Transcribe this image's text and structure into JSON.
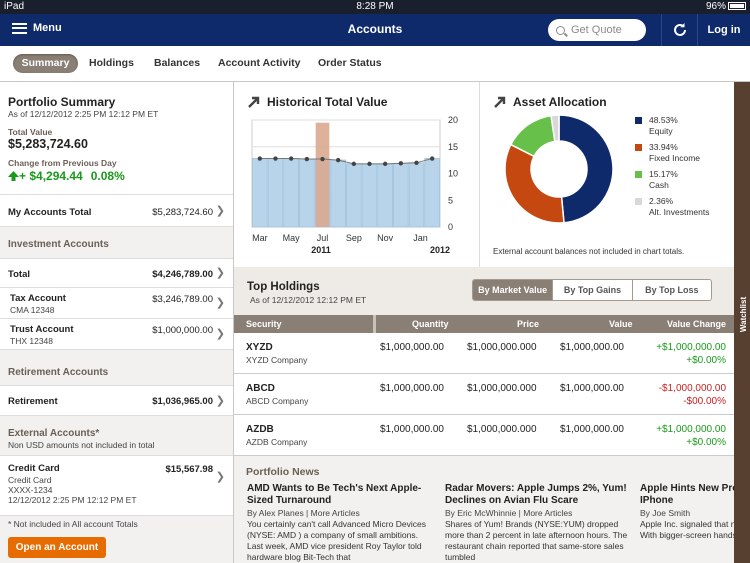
{
  "status_bar": {
    "device": "iPad",
    "time": "8:28 PM",
    "battery": "96%"
  },
  "nav": {
    "menu_label": "Menu",
    "title": "Accounts",
    "quote_placeholder": "Get Quote",
    "login_label": "Log in"
  },
  "tabs": [
    "Summary",
    "Holdings",
    "Balances",
    "Account Activity",
    "Order Status"
  ],
  "left": {
    "portfolio_title": "Portfolio Summary",
    "as_of": "As of 12/12/2012 2:25 PM 12:12 PM ET",
    "total_value_label": "Total Value",
    "total_value": "$5,283,724.60",
    "change_label": "Change from Previous Day",
    "change_value": "+ $4,294.44",
    "change_pct": "0.08%",
    "my_accounts_label": "My Accounts Total",
    "my_accounts_value": "$5,283,724.60",
    "investment_header": "Investment Accounts",
    "inv_total_label": "Total",
    "inv_total_value": "$4,246,789.00",
    "tax_label": "Tax Account",
    "tax_sub": "CMA 12348",
    "tax_value": "$3,246,789.00",
    "trust_label": "Trust Account",
    "trust_sub": "THX 12348",
    "trust_value": "$1,000,000.00",
    "retirement_header": "Retirement Accounts",
    "retirement_label": "Retirement",
    "retirement_value": "$1,036,965.00",
    "external_header": "External Accounts*",
    "external_note": "Non USD amounts not included in total",
    "cc_label": "Credit Card",
    "cc_value": "$15,567.98",
    "cc_sub1": "Credit Card",
    "cc_sub2": "XXXX-1234",
    "cc_sub3": "12/12/2012 2:25 PM 12:12 PM ET",
    "footnote": "* Not included in All account Totals",
    "open_account": "Open an Account"
  },
  "historical": {
    "title": "Historical Total Value"
  },
  "allocation": {
    "title": "Asset Allocation",
    "legend": [
      {
        "pct": "48.53%",
        "label": "Equity",
        "color": "#0e2a6b"
      },
      {
        "pct": "33.94%",
        "label": "Fixed Income",
        "color": "#c4480f"
      },
      {
        "pct": "15.17%",
        "label": "Cash",
        "color": "#66c04a"
      },
      {
        "pct": "2.36%",
        "label": "Alt. Investments",
        "color": "#d8d8d8"
      }
    ],
    "note": "External account balances not included in chart totals."
  },
  "chart_data": [
    {
      "type": "bar",
      "x_ticks": [
        "Mar",
        "May",
        "Jul",
        "Sep",
        "Nov",
        "Jan"
      ],
      "x_year_labels": [
        "2011",
        "2012"
      ],
      "y_ticks": [
        "0",
        "5",
        "10",
        "15",
        "20"
      ],
      "ylim": [
        0,
        20
      ],
      "values": [
        12.8,
        12.8,
        12.8,
        12.7,
        12.7,
        12.5,
        11.8,
        11.8,
        11.8,
        11.9,
        12.0,
        12.8
      ],
      "highlight_index": 4,
      "highlight_value": 19.5,
      "bar_color": "#b8d4ea",
      "highlight_color": "#d9a98f",
      "grid": true
    },
    {
      "type": "pie",
      "labels": [
        "Equity",
        "Fixed Income",
        "Cash",
        "Alt. Investments"
      ],
      "values": [
        48.53,
        33.94,
        15.17,
        2.36
      ],
      "colors": [
        "#0e2a6b",
        "#c4480f",
        "#66c04a",
        "#d8d8d8"
      ]
    }
  ],
  "holdings": {
    "title": "Top Holdings",
    "as_of": "As of 12/12/2012 12:12 PM ET",
    "filters": [
      "By Market Value",
      "By Top Gains",
      "By Top Loss"
    ],
    "columns": [
      "Security",
      "Quantity",
      "Price",
      "Value",
      "Value Change"
    ],
    "rows": [
      {
        "sym": "XYZD",
        "co": "XYZD Company",
        "qty": "$1,000,000.00",
        "price": "$1,000,000.000",
        "value": "$1,000,000.00",
        "chg1": "+$1,000,000.00",
        "chg2": "+$0.00%",
        "dir": "pos"
      },
      {
        "sym": "ABCD",
        "co": "ABCD Company",
        "qty": "$1,000,000.00",
        "price": "$1,000,000.000",
        "value": "$1,000,000.00",
        "chg1": "-$1,000,000.00",
        "chg2": "-$00.00%",
        "dir": "neg"
      },
      {
        "sym": "AZDB",
        "co": "AZDB Company",
        "qty": "$1,000,000.00",
        "price": "$1,000,000.000",
        "value": "$1,000,000.00",
        "chg1": "+$1,000,000.00",
        "chg2": "+$0.00%",
        "dir": "pos"
      }
    ]
  },
  "news": {
    "title": "Portfolio News",
    "items": [
      {
        "headline": "AMD Wants to Be Tech's Next Apple-Sized Turnaround",
        "byline": "By Alex Planes | More Articles",
        "text": "You certainly can't call Advanced Micro Devices (NYSE: AMD ) a company of small ambitions. Last week, AMD vice president Roy Taylor told hardware blog Bit-Tech that"
      },
      {
        "headline": "Radar Movers: Apple Jumps 2%, Yum! Declines on Avian Flu Scare",
        "byline": "By Eric McWhinnie | More Articles",
        "text": "Shares of Yum! Brands (NYSE:YUM) dropped more than 2 percent in late afternoon hours. The restaurant chain reported that same-store sales tumbled"
      },
      {
        "headline": "Apple Hints New Products With Bigger IPhone",
        "byline": "By Joe Smith",
        "text": "Apple Inc. signaled that new products is coming With bigger-screen handset development, Apple"
      }
    ]
  },
  "watchlist": {
    "label": "Watchlist"
  }
}
